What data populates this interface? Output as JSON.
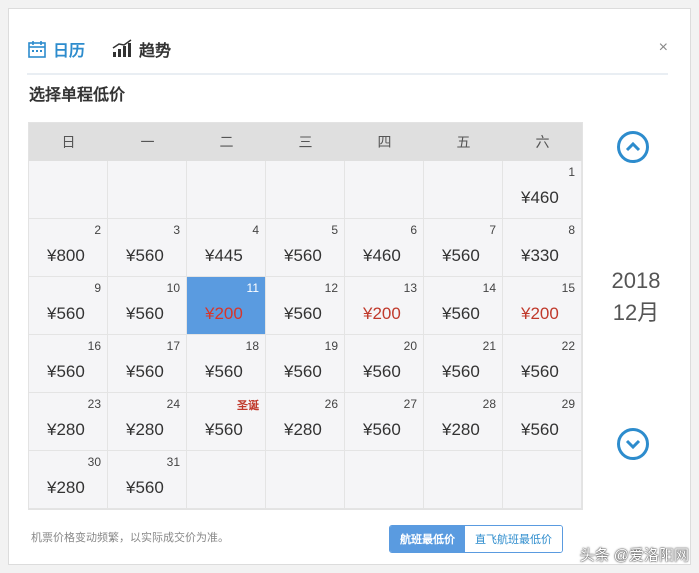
{
  "tabs": {
    "calendar_label": "日历",
    "trend_label": "趋势"
  },
  "close_label": "×",
  "subtitle": "选择单程低价",
  "weekdays": [
    "日",
    "一",
    "二",
    "三",
    "四",
    "五",
    "六"
  ],
  "month": {
    "year": "2018",
    "month": "12月"
  },
  "cells": [
    {
      "day": "",
      "price": ""
    },
    {
      "day": "",
      "price": ""
    },
    {
      "day": "",
      "price": ""
    },
    {
      "day": "",
      "price": ""
    },
    {
      "day": "",
      "price": ""
    },
    {
      "day": "",
      "price": ""
    },
    {
      "day": "1",
      "price": "¥460"
    },
    {
      "day": "2",
      "price": "¥800"
    },
    {
      "day": "3",
      "price": "¥560"
    },
    {
      "day": "4",
      "price": "¥445"
    },
    {
      "day": "5",
      "price": "¥560"
    },
    {
      "day": "6",
      "price": "¥460"
    },
    {
      "day": "7",
      "price": "¥560"
    },
    {
      "day": "8",
      "price": "¥330"
    },
    {
      "day": "9",
      "price": "¥560"
    },
    {
      "day": "10",
      "price": "¥560"
    },
    {
      "day": "11",
      "price": "¥200",
      "low": true,
      "selected": true
    },
    {
      "day": "12",
      "price": "¥560"
    },
    {
      "day": "13",
      "price": "¥200",
      "low": true
    },
    {
      "day": "14",
      "price": "¥560"
    },
    {
      "day": "15",
      "price": "¥200",
      "low": true
    },
    {
      "day": "16",
      "price": "¥560"
    },
    {
      "day": "17",
      "price": "¥560"
    },
    {
      "day": "18",
      "price": "¥560"
    },
    {
      "day": "19",
      "price": "¥560"
    },
    {
      "day": "20",
      "price": "¥560"
    },
    {
      "day": "21",
      "price": "¥560"
    },
    {
      "day": "22",
      "price": "¥560"
    },
    {
      "day": "23",
      "price": "¥280"
    },
    {
      "day": "24",
      "price": "¥280"
    },
    {
      "day": "圣诞",
      "price": "¥560",
      "holiday": true
    },
    {
      "day": "26",
      "price": "¥280"
    },
    {
      "day": "27",
      "price": "¥560"
    },
    {
      "day": "28",
      "price": "¥280"
    },
    {
      "day": "29",
      "price": "¥560"
    },
    {
      "day": "30",
      "price": "¥280"
    },
    {
      "day": "31",
      "price": "¥560"
    },
    {
      "day": "",
      "price": ""
    },
    {
      "day": "",
      "price": ""
    },
    {
      "day": "",
      "price": ""
    },
    {
      "day": "",
      "price": ""
    },
    {
      "day": "",
      "price": ""
    }
  ],
  "footnote": "机票价格变动频繁，以实际成交价为准。",
  "buttons": {
    "flight_lowest": "航班最低价",
    "direct_lowest": "直飞航班最低价"
  },
  "watermark": "头条 @爱洛阳网",
  "colors": {
    "accent": "#2d8ccd",
    "selected": "#5a9be0",
    "low_price": "#c0392b"
  }
}
